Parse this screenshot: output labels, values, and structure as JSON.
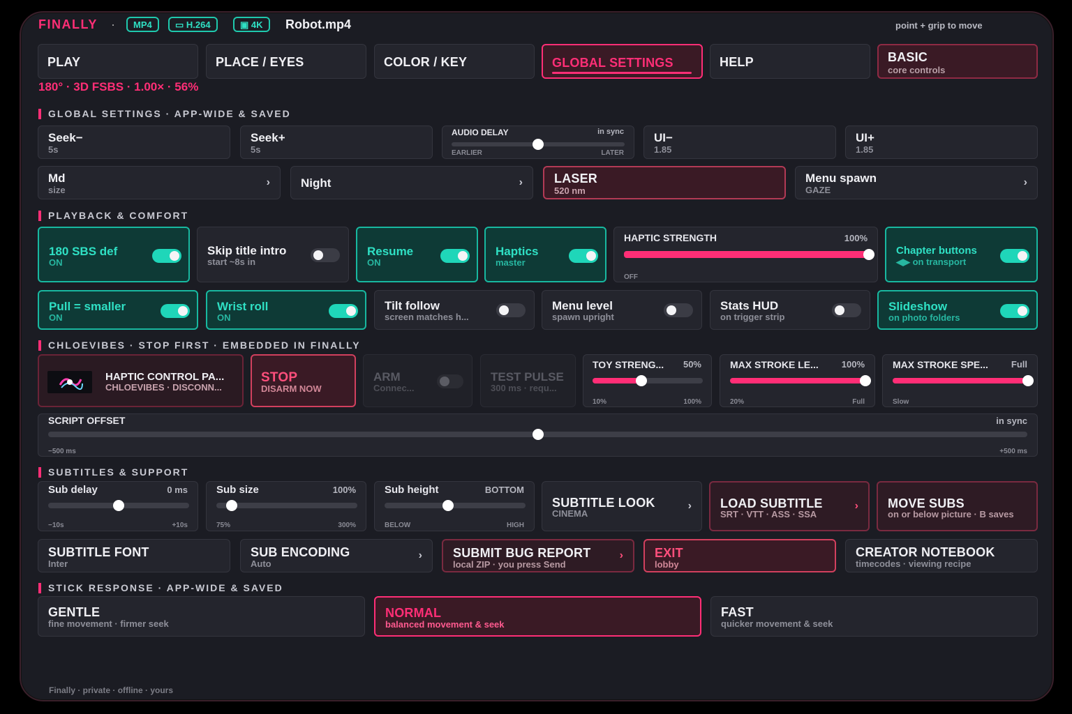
{
  "header": {
    "brand": "FINALLY",
    "dot": "·",
    "badges": [
      "MP4",
      "▭ H.264",
      "▣ 4K"
    ],
    "filename": "Robot.mp4",
    "hint": "point + grip to move"
  },
  "tabs": [
    {
      "label": "PLAY"
    },
    {
      "label": "PLACE / EYES"
    },
    {
      "label": "COLOR / KEY"
    },
    {
      "label": "GLOBAL SETTINGS"
    },
    {
      "label": "HELP"
    },
    {
      "label": "BASIC",
      "sub": "core controls"
    }
  ],
  "status_line": "180° · 3D FSBS · 1.00× · 56%",
  "sections": {
    "global": "GLOBAL SETTINGS · APP-WIDE & SAVED",
    "playback": "PLAYBACK & COMFORT",
    "chloe": "CHLOEVIBES · STOP FIRST · EMBEDDED IN FINALLY",
    "subs": "SUBTITLES & SUPPORT",
    "stick": "STICK RESPONSE · APP-WIDE & SAVED"
  },
  "global_row1": {
    "seek_minus": {
      "title": "Seek−",
      "sub": "5s"
    },
    "seek_plus": {
      "title": "Seek+",
      "sub": "5s"
    },
    "audio_delay": {
      "label": "AUDIO DELAY",
      "value": "in sync",
      "min": "EARLIER",
      "max": "LATER",
      "level": 0.5
    },
    "ui_minus": {
      "title": "UI−",
      "sub": "1.85"
    },
    "ui_plus": {
      "title": "UI+",
      "sub": "1.85"
    }
  },
  "global_row2": {
    "size": {
      "title": "Md",
      "sub": "size"
    },
    "night": {
      "title": "Night"
    },
    "laser": {
      "title": "LASER",
      "sub": "520 nm"
    },
    "menu_spawn": {
      "title": "Menu spawn",
      "sub": "GAZE"
    }
  },
  "playback_row1": {
    "sbs": {
      "title": "180 SBS def",
      "sub": "ON"
    },
    "skip": {
      "title": "Skip title intro",
      "sub": "start ~8s in"
    },
    "resume": {
      "title": "Resume",
      "sub": "ON"
    },
    "haptics": {
      "title": "Haptics",
      "sub": "master"
    },
    "haptic_strength": {
      "label": "HAPTIC STRENGTH",
      "value": "100%",
      "min": "OFF",
      "level": 1.0
    },
    "chapter": {
      "title": "Chapter buttons",
      "sub": "◀▶ on transport"
    }
  },
  "playback_row2": {
    "pull": {
      "title": "Pull = smaller",
      "sub": "ON"
    },
    "wrist": {
      "title": "Wrist roll",
      "sub": "ON"
    },
    "tilt": {
      "title": "Tilt follow",
      "sub": "screen matches h..."
    },
    "menu_level": {
      "title": "Menu level",
      "sub": "spawn upright"
    },
    "stats": {
      "title": "Stats HUD",
      "sub": "on trigger strip"
    },
    "slideshow": {
      "title": "Slideshow",
      "sub": "on photo folders"
    }
  },
  "chloe_row": {
    "haptic_panel": {
      "title": "HAPTIC CONTROL PA...",
      "sub": "CHLOEVIBES · DISCONN..."
    },
    "stop": {
      "title": "STOP",
      "sub": "DISARM NOW"
    },
    "arm": {
      "title": "ARM",
      "sub": "Connec..."
    },
    "test": {
      "title": "TEST PULSE",
      "sub": "300 ms · requ..."
    },
    "toy": {
      "label": "TOY STRENG...",
      "value": "50%",
      "min": "10%",
      "max": "100%",
      "level": 0.44
    },
    "stroke_len": {
      "label": "MAX STROKE LE...",
      "value": "100%",
      "min": "20%",
      "max": "Full",
      "level": 1.0
    },
    "stroke_spd": {
      "label": "MAX STROKE SPE...",
      "value": "Full",
      "min": "Slow",
      "level": 1.0
    }
  },
  "script_offset": {
    "label": "SCRIPT OFFSET",
    "value": "in sync",
    "min": "−500 ms",
    "max": "+500 ms",
    "level": 0.5
  },
  "subs_row1": {
    "delay": {
      "label": "Sub delay",
      "value": "0 ms",
      "min": "−10s",
      "max": "+10s",
      "level": 0.5
    },
    "size": {
      "label": "Sub size",
      "value": "100%",
      "min": "75%",
      "max": "300%",
      "level": 0.11
    },
    "height": {
      "label": "Sub height",
      "value": "BOTTOM",
      "min": "BELOW",
      "max": "HIGH",
      "level": 0.45
    },
    "look": {
      "title": "SUBTITLE LOOK",
      "sub": "CINEMA"
    },
    "load": {
      "title": "LOAD SUBTITLE",
      "sub": "SRT · VTT · ASS · SSA"
    },
    "move": {
      "title": "MOVE SUBS",
      "sub": "on or below picture · B saves"
    }
  },
  "subs_row2": {
    "font": {
      "title": "SUBTITLE FONT",
      "sub": "Inter"
    },
    "encoding": {
      "title": "SUB ENCODING",
      "sub": "Auto"
    },
    "bug": {
      "title": "SUBMIT BUG REPORT",
      "sub": "local ZIP · you press Send"
    },
    "exit": {
      "title": "EXIT",
      "sub": "lobby"
    },
    "notebook": {
      "title": "CREATOR NOTEBOOK",
      "sub": "timecodes · viewing recipe"
    }
  },
  "stick": {
    "gentle": {
      "title": "GENTLE",
      "sub": "fine movement · firmer seek"
    },
    "normal": {
      "title": "NORMAL",
      "sub": "balanced movement & seek"
    },
    "fast": {
      "title": "FAST",
      "sub": "quicker movement & seek"
    }
  },
  "footer": "Finally · private · offline · yours",
  "colors": {
    "accent": "#ff2e76",
    "teal": "#1fd6b9",
    "panel": "#1b1c23"
  }
}
